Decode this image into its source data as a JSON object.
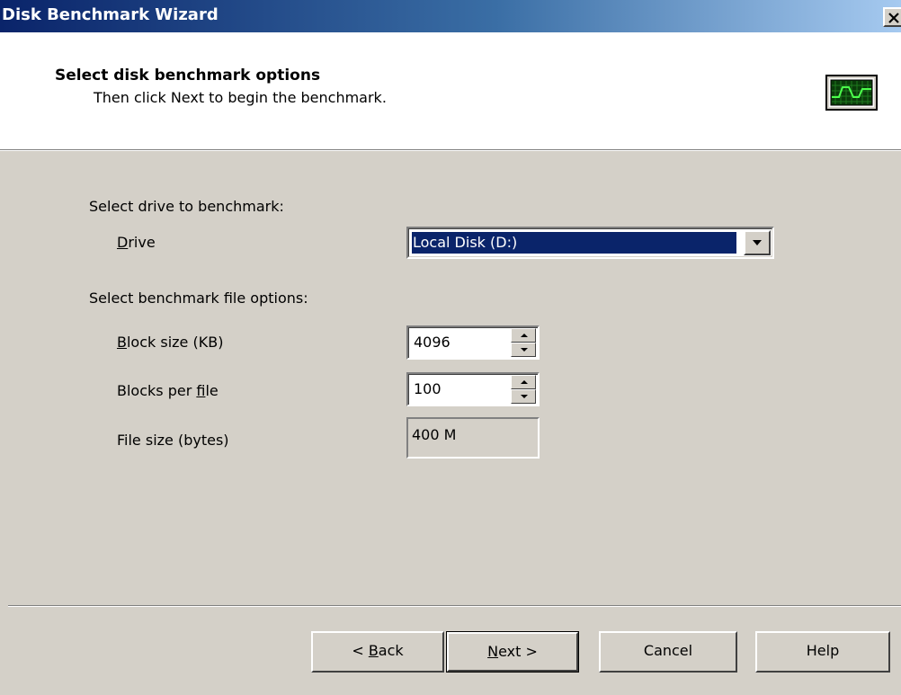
{
  "window": {
    "title": "Disk Benchmark Wizard",
    "close_glyph": "✕"
  },
  "header": {
    "title": "Select disk benchmark options",
    "subtitle": "Then click Next to begin the benchmark.",
    "icon": "monitor-waveform-icon"
  },
  "drive_section": {
    "heading": "Select drive to benchmark:",
    "drive_label_accel": "D",
    "drive_label_rest": "rive",
    "drive_value": "Local Disk (D:)"
  },
  "file_section": {
    "heading": "Select benchmark file options:",
    "block_size_label_accel": "B",
    "block_size_label_rest": "lock size (KB)",
    "block_size_value": "4096",
    "blocks_per_file_label_pre": "Blocks per ",
    "blocks_per_file_label_accel": "f",
    "blocks_per_file_label_rest": "ile",
    "blocks_per_file_value": "100",
    "file_size_label": "File size (bytes)",
    "file_size_value": "400 M"
  },
  "footer": {
    "back_pre": "< ",
    "back_accel": "B",
    "back_rest": "ack",
    "next_accel": "N",
    "next_rest": "ext >",
    "cancel": "Cancel",
    "help": "Help"
  },
  "colors": {
    "titlebar_start": "#0a246a",
    "titlebar_end": "#a6caf0",
    "dialog_face": "#d4d0c8",
    "selection": "#0a246a"
  }
}
